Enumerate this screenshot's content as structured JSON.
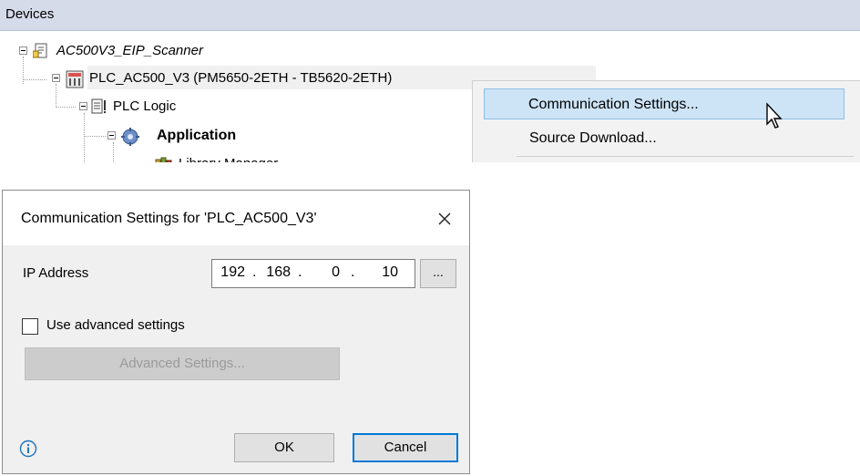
{
  "devices_panel": {
    "title": "Devices",
    "tree": [
      {
        "label": "AC500V3_EIP_Scanner",
        "icon": "project-icon"
      },
      {
        "label": "PLC_AC500_V3 (PM5650-2ETH - TB5620-2ETH)",
        "icon": "plc-device-icon"
      },
      {
        "label": "PLC Logic",
        "icon": "plc-logic-icon"
      },
      {
        "label": "Application",
        "icon": "application-gear-icon"
      },
      {
        "label": "Library Manager",
        "icon": "library-icon"
      }
    ]
  },
  "context_menu": {
    "items": [
      {
        "label": "Communication Settings..."
      },
      {
        "label": "Source Download..."
      }
    ]
  },
  "dialog": {
    "title": "Communication Settings for 'PLC_AC500_V3'",
    "ip_label": "IP Address",
    "ip": {
      "o1": "192",
      "o2": "168",
      "o3": "0",
      "o4": "10"
    },
    "browse_label": "...",
    "use_advanced_label": "Use advanced settings",
    "use_advanced_checked": false,
    "advanced_button_label": "Advanced Settings...",
    "ok_label": "OK",
    "cancel_label": "Cancel"
  },
  "colors": {
    "header_bg": "#d6dbe9",
    "menu_highlight": "#cde4f7",
    "focus_border": "#0078d7",
    "info_icon": "#1e73be"
  }
}
